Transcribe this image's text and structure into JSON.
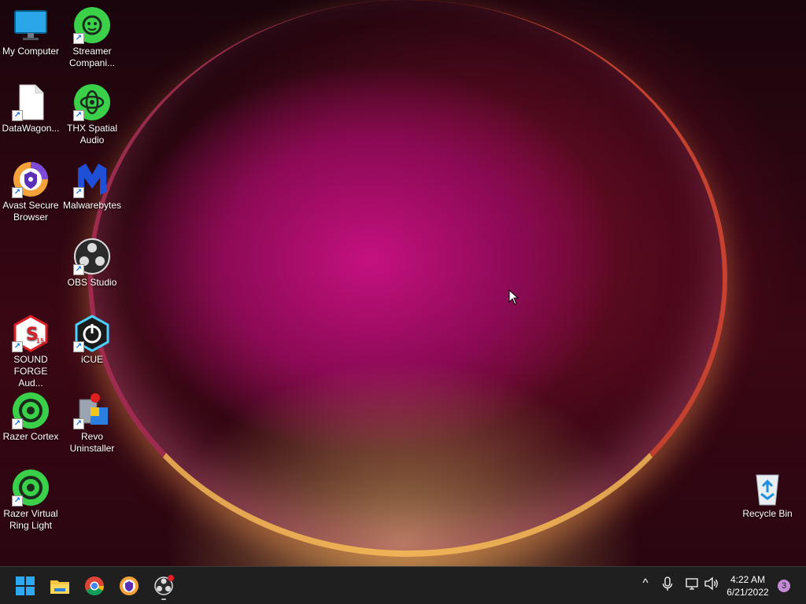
{
  "desktop": {
    "icons": [
      {
        "label": "My Computer",
        "icon": "monitor-icon"
      },
      {
        "label": "Streamer Compani...",
        "icon": "streamer-companion-icon"
      },
      {
        "label": "DataWagon...",
        "icon": "file-icon"
      },
      {
        "label": "THX Spatial Audio",
        "icon": "thx-icon"
      },
      {
        "label": "Avast Secure Browser",
        "icon": "avast-browser-icon"
      },
      {
        "label": "Malwarebytes",
        "icon": "malwarebytes-icon"
      },
      {
        "label": "OBS Studio",
        "icon": "obs-icon"
      },
      {
        "label": "SOUND FORGE Aud...",
        "icon": "sound-forge-icon"
      },
      {
        "label": "iCUE",
        "icon": "icue-icon"
      },
      {
        "label": "Razer Cortex",
        "icon": "razer-cortex-icon"
      },
      {
        "label": "Revo Uninstaller",
        "icon": "revo-uninstaller-icon"
      },
      {
        "label": "Razer Virtual Ring Light",
        "icon": "razer-ring-light-icon"
      },
      {
        "label": "Recycle Bin",
        "icon": "recycle-bin-icon"
      }
    ]
  },
  "taskbar": {
    "apps": [
      "start-icon",
      "file-explorer-icon",
      "chrome-icon",
      "avast-browser-icon",
      "obs-icon"
    ],
    "tray": {
      "chevron": "^",
      "time": "4:22 AM",
      "date": "6/21/2022",
      "notifications": "3"
    }
  },
  "colors": {
    "accent_green": "#3ad04a",
    "taskbar_bg": "#1f1f1f"
  }
}
